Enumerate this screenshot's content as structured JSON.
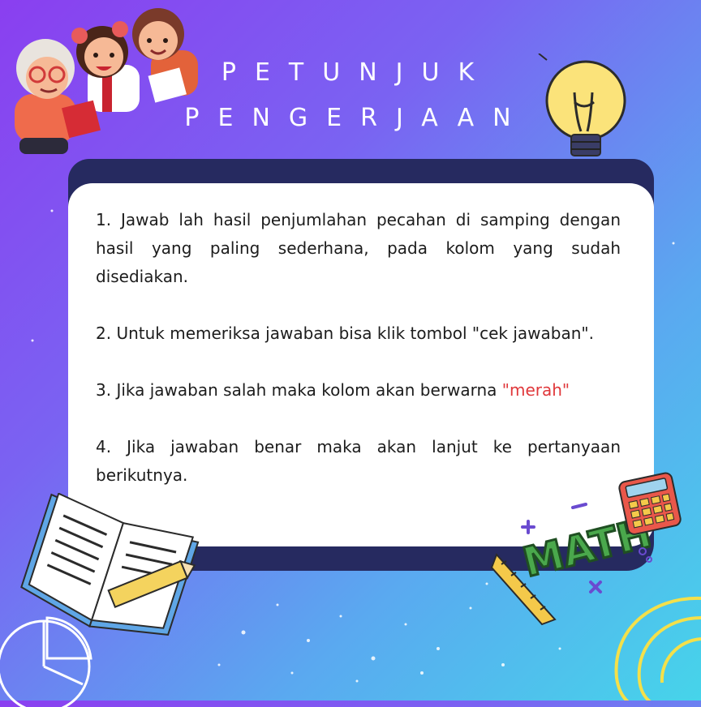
{
  "title": {
    "line1": "PETUNJUK",
    "line2": "PENGERJAAN"
  },
  "instructions": [
    {
      "text": "1.  Jawab lah hasil penjumlahan pecahan di samping dengan hasil yang paling sederhana, pada kolom yang sudah disediakan."
    },
    {
      "text": "2. Untuk memeriksa jawaban bisa klik tombol \"cek jawaban\"."
    },
    {
      "text_before": "3.  Jika jawaban salah maka kolom akan berwarna ",
      "highlight": "\"merah\""
    },
    {
      "text": "4. Jika jawaban benar maka akan lanjut ke pertanyaan berikutnya."
    }
  ],
  "math_sticker": {
    "label": "MATH"
  },
  "colors": {
    "background_start": "#8a3ff0",
    "background_end": "#46d4ea",
    "frame": "#262a60",
    "card": "#ffffff",
    "highlight": "#e0383b"
  },
  "icons": [
    "children-reading-illustration",
    "lightbulb-icon",
    "open-book-icon",
    "ruler-icon",
    "pencil-icon",
    "calculator-icon",
    "math-sticker-icon",
    "pie-chart-icon",
    "spiral-decoration"
  ]
}
